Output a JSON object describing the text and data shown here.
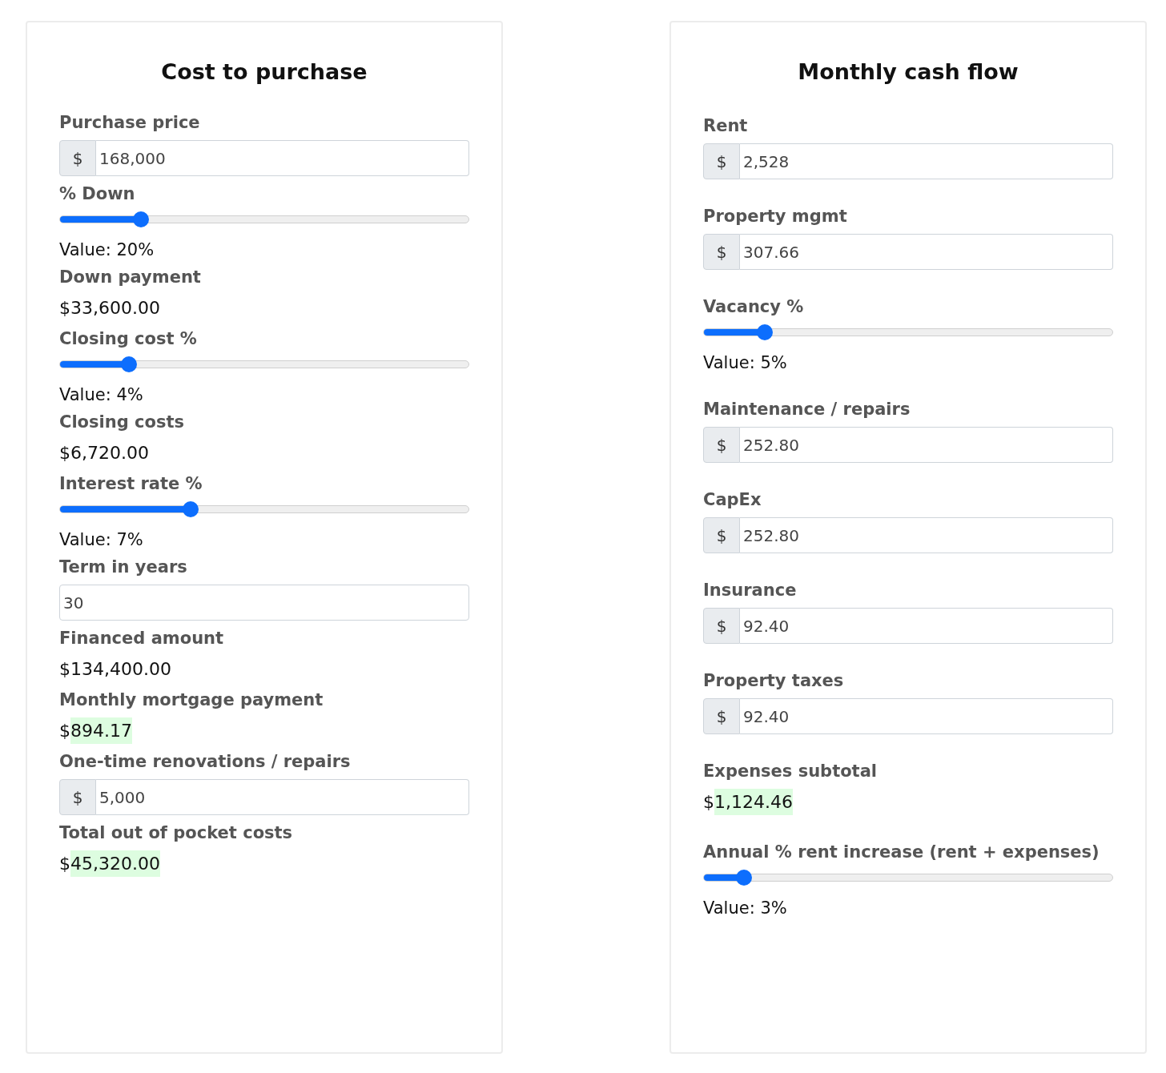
{
  "panels": [
    {
      "title": "Cost to purchase",
      "fields": [
        {
          "kind": "money_input",
          "label": "Purchase price",
          "prefix": "$",
          "value": "168,000"
        },
        {
          "kind": "slider",
          "label": "% Down",
          "level": 0.2,
          "reading": "Value: 20%"
        },
        {
          "kind": "output",
          "label": "Down payment",
          "currency": "$",
          "amount": "33,600.00",
          "highlighted": false
        },
        {
          "kind": "slider",
          "label": "Closing cost %",
          "level": 0.17,
          "reading": "Value: 4%"
        },
        {
          "kind": "output",
          "label": "Closing costs",
          "currency": "$",
          "amount": "6,720.00",
          "highlighted": false
        },
        {
          "kind": "slider",
          "label": "Interest rate %",
          "level": 0.32,
          "reading": "Value: 7%"
        },
        {
          "kind": "text_input",
          "label": "Term in years",
          "value": "30"
        },
        {
          "kind": "output",
          "label": "Financed amount",
          "currency": "$",
          "amount": "134,400.00",
          "highlighted": false
        },
        {
          "kind": "output",
          "label": "Monthly mortgage payment",
          "currency": "$",
          "amount": "894.17",
          "highlighted": true
        },
        {
          "kind": "money_input",
          "label": "One-time renovations / repairs",
          "prefix": "$",
          "value": "5,000"
        },
        {
          "kind": "output",
          "label": "Total out of pocket costs",
          "currency": "$",
          "amount": "45,320.00",
          "highlighted": true
        }
      ]
    },
    {
      "title": "Monthly cash flow",
      "fields": [
        {
          "kind": "money_input",
          "label": "Rent",
          "prefix": "$",
          "value": "2,528"
        },
        {
          "kind": "money_input",
          "label": "Property mgmt",
          "prefix": "$",
          "value": "307.66"
        },
        {
          "kind": "slider",
          "label": "Vacancy %",
          "level": 0.15,
          "reading": "Value: 5%"
        },
        {
          "kind": "money_input",
          "label": "Maintenance / repairs",
          "prefix": "$",
          "value": "252.80"
        },
        {
          "kind": "money_input",
          "label": "CapEx",
          "prefix": "$",
          "value": "252.80"
        },
        {
          "kind": "money_input",
          "label": "Insurance",
          "prefix": "$",
          "value": "92.40"
        },
        {
          "kind": "money_input",
          "label": "Property taxes",
          "prefix": "$",
          "value": "92.40"
        },
        {
          "kind": "output",
          "label": "Expenses subtotal",
          "currency": "$",
          "amount": "1,124.46",
          "highlighted": true
        },
        {
          "kind": "slider",
          "label": "Annual % rent increase (rent + expenses)",
          "level": 0.1,
          "reading": "Value: 3%"
        }
      ]
    }
  ]
}
